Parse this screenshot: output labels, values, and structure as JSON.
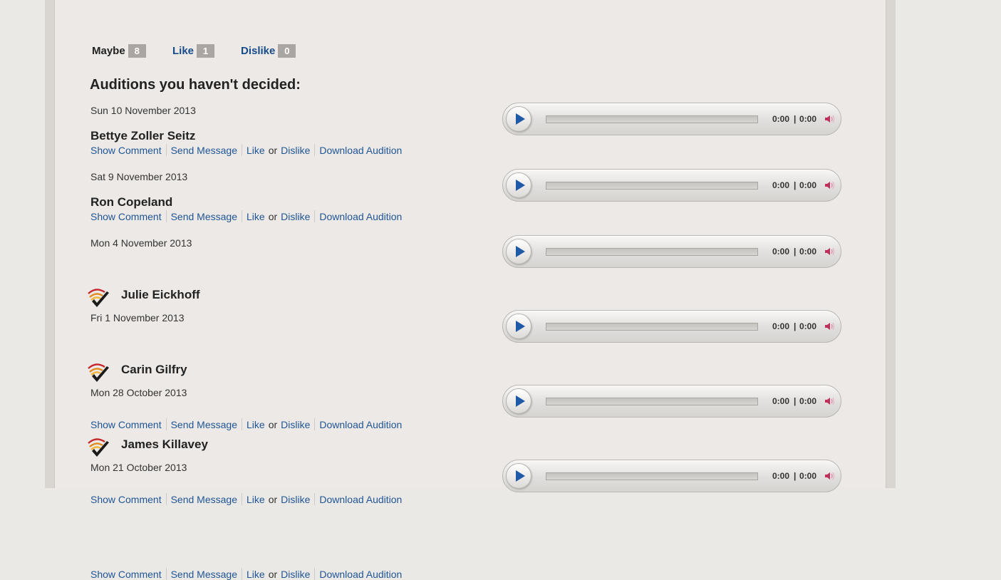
{
  "filters": [
    {
      "label": "Maybe",
      "count": "8",
      "active": true
    },
    {
      "label": "Like",
      "count": "1",
      "active": false
    },
    {
      "label": "Dislike",
      "count": "0",
      "active": false
    }
  ],
  "heading": "Auditions you haven't decided:",
  "actions": {
    "show_comment": "Show Comment",
    "send_message": "Send Message",
    "like": "Like",
    "or": "or",
    "dislike": "Dislike",
    "download": "Download Audition"
  },
  "player": {
    "current": "0:00",
    "separator": "|",
    "duration": "0:00"
  },
  "auditions": [
    {
      "date": "Sun 10 November 2013",
      "name": "Bettye Zoller Seitz",
      "verified": false
    },
    {
      "date": "Sat 9 November 2013",
      "name": "Ron Copeland",
      "verified": false
    },
    {
      "date": "Mon 4 November 2013",
      "name": "Julie Eickhoff",
      "verified": true
    },
    {
      "date": "Fri 1 November 2013",
      "name": "Carin Gilfry",
      "verified": true
    },
    {
      "date": "Mon 28 October 2013",
      "name": "James Killavey",
      "verified": true
    },
    {
      "date": "Mon 21 October 2013"
    }
  ],
  "colors": {
    "link": "#1f5596",
    "tab_link": "#184b8a",
    "count_badge": "#aaa6a3",
    "play_icon": "#1f5aa6",
    "volume_icon": "#c0305a"
  },
  "icons": {
    "badge": "verified-checkmark-icon",
    "play": "play-icon",
    "volume": "speaker-volume-icon"
  }
}
